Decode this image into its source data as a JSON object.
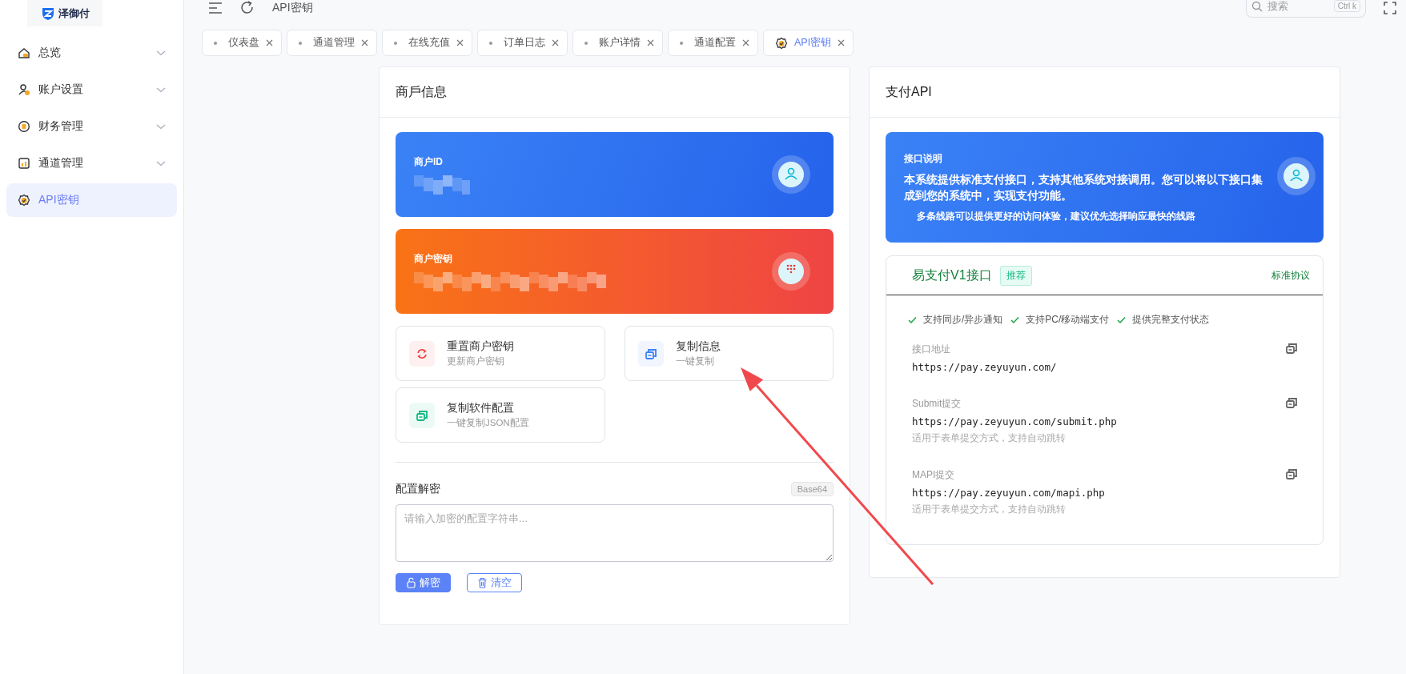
{
  "sidebar": {
    "logo": "泽御付",
    "items": [
      {
        "label": "总览",
        "expandable": true,
        "selected": false
      },
      {
        "label": "账户设置",
        "expandable": true,
        "selected": false
      },
      {
        "label": "财务管理",
        "expandable": true,
        "selected": false
      },
      {
        "label": "通道管理",
        "expandable": true,
        "selected": false
      },
      {
        "label": "API密钥",
        "expandable": false,
        "selected": true
      }
    ]
  },
  "topbar": {
    "breadcrumb": "API密钥",
    "search": {
      "placeholder": "搜索",
      "shortcut": [
        "Ctrl",
        "k"
      ]
    }
  },
  "tabs": [
    {
      "label": "仪表盘",
      "selected": false
    },
    {
      "label": "通道管理",
      "selected": false
    },
    {
      "label": "在线充值",
      "selected": false
    },
    {
      "label": "订单日志",
      "selected": false
    },
    {
      "label": "账户详情",
      "selected": false
    },
    {
      "label": "通道配置",
      "selected": false
    },
    {
      "label": "API密钥",
      "selected": true
    }
  ],
  "merchant_panel": {
    "title": "商戶信息",
    "cards": [
      {
        "label": "商户ID",
        "kind": "id"
      },
      {
        "label": "商户密钥",
        "kind": "key"
      }
    ],
    "actions": [
      {
        "title": "重置商户密钥",
        "subtitle": "更新商户密钥",
        "color": "#ef4444"
      },
      {
        "title": "复制信息",
        "subtitle": "一键复制",
        "color": "#3b82f6"
      },
      {
        "title": "复制软件配置",
        "subtitle": "一键复制JSON配置",
        "color": "#10b981"
      }
    ],
    "decrypt": {
      "label": "配置解密",
      "badge": "Base64",
      "placeholder": "请输入加密的配置字符串...",
      "buttons": [
        {
          "label": "解密",
          "kind": "primary"
        },
        {
          "label": "清空",
          "kind": "outline"
        }
      ]
    }
  },
  "api_panel": {
    "title": "支付API",
    "intro": {
      "label": "接口说明",
      "text": "本系统提供标准支付接口，支持其他系统对接调用。您可以将以下接口集成到您的系统中，实现支付功能。",
      "note": "多条线路可以提供更好的访问体验，建议优先选择响应最快的线路"
    },
    "interface": {
      "name": "易支付V1接口",
      "badge": "推荐",
      "protocol": "标准协议",
      "features": [
        "支持同步/异步通知",
        "支持PC/移动端支付",
        "提供完整支付状态"
      ],
      "endpoints": [
        {
          "label": "接口地址",
          "url": "https://pay.zeyuyun.com/"
        },
        {
          "label": "Submit提交",
          "url": "https://pay.zeyuyun.com/submit.php",
          "hint": "适用于表单提交方式，支持自动跳转"
        },
        {
          "label": "MAPI提交",
          "url": "https://pay.zeyuyun.com/mapi.php",
          "hint": "适用于表单提交方式，支持自动跳转"
        }
      ]
    }
  }
}
